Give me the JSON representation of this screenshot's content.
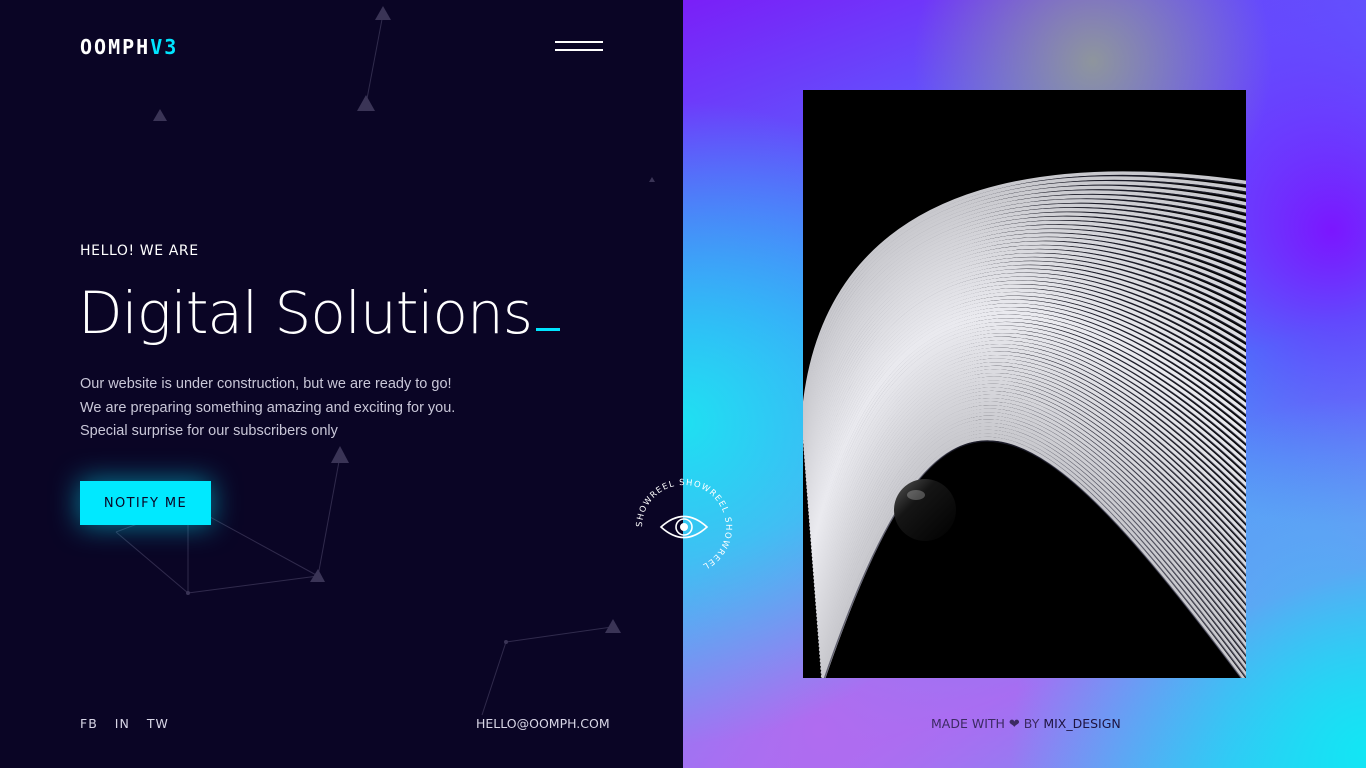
{
  "header": {
    "logo_main": "OOMPH",
    "logo_accent": "V3",
    "menu_icon": "hamburger-menu-icon"
  },
  "hero": {
    "eyebrow": "HELLO! WE ARE",
    "headline": "Digital Solutions",
    "intro_lines": [
      "Our website is under construction, but we are ready to go!",
      "We are preparing something amazing and exciting for you.",
      "Special surprise for our subscribers only"
    ],
    "cta_label": "NOTIFY ME"
  },
  "footer": {
    "social": [
      "FB",
      "IN",
      "TW"
    ],
    "email": "HELLO@OOMPH.COM",
    "credit_prefix": "MADE WITH",
    "credit_icon": "heart-icon",
    "credit_by": "BY",
    "credit_brand": "MIX_DESIGN"
  },
  "showreel": {
    "ring_text": "SHOWREEL SHOWREEL SHOWREEL ",
    "icon": "eye-icon"
  },
  "colors": {
    "background": "#0a0525",
    "accent": "#00e9ff",
    "text": "#ffffff"
  }
}
